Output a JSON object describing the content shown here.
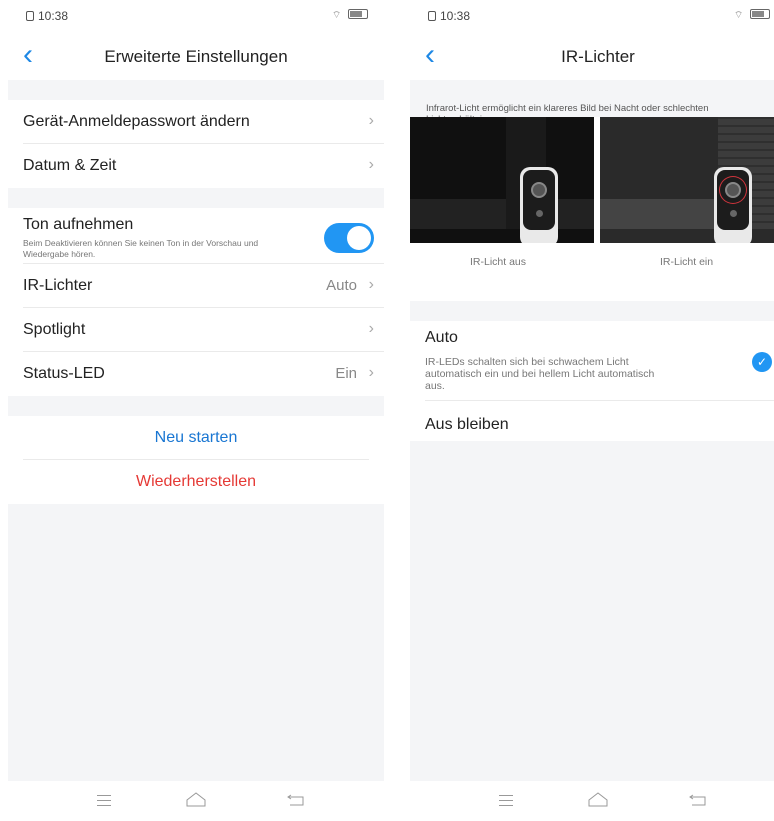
{
  "status": {
    "time": "10:38"
  },
  "left": {
    "title": "Erweiterte Einstellungen",
    "rows": [
      {
        "label": "Gerät-Anmeldepasswort ändern",
        "value": ""
      },
      {
        "label": "Datum & Zeit",
        "value": ""
      }
    ],
    "sound": {
      "label": "Ton aufnehmen",
      "description": "Beim Deaktivieren können Sie keinen Ton in der Vorschau und Wiedergabe hören.",
      "enabled": true
    },
    "rows2": [
      {
        "label": "IR-Lichter",
        "value": "Auto"
      },
      {
        "label": "Spotlight",
        "value": ""
      },
      {
        "label": "Status-LED",
        "value": "Ein"
      }
    ],
    "actions": {
      "restart": "Neu starten",
      "restore": "Wiederherstellen"
    }
  },
  "right": {
    "title": "IR-Lichter",
    "info": "Infrarot-Licht ermöglicht ein klareres Bild bei Nacht oder schlechten Lichtverhältnissen.",
    "captions": {
      "off": "IR-Licht aus",
      "on": "IR-Licht ein"
    },
    "options": {
      "auto": {
        "label": "Auto",
        "description": "IR-LEDs schalten sich bei schwachem Licht automatisch ein und bei hellem Licht automatisch aus.",
        "selected": true
      },
      "off": {
        "label": "Aus bleiben",
        "selected": false
      }
    }
  },
  "colors": {
    "accent": "#2196f3",
    "danger": "#e53935",
    "background": "#f4f5f7"
  },
  "icons": [
    "back-chevron-icon",
    "chevron-right-icon",
    "checkmark-icon",
    "menu-icon",
    "home-icon",
    "back-key-icon",
    "wifi-icon",
    "battery-icon"
  ]
}
